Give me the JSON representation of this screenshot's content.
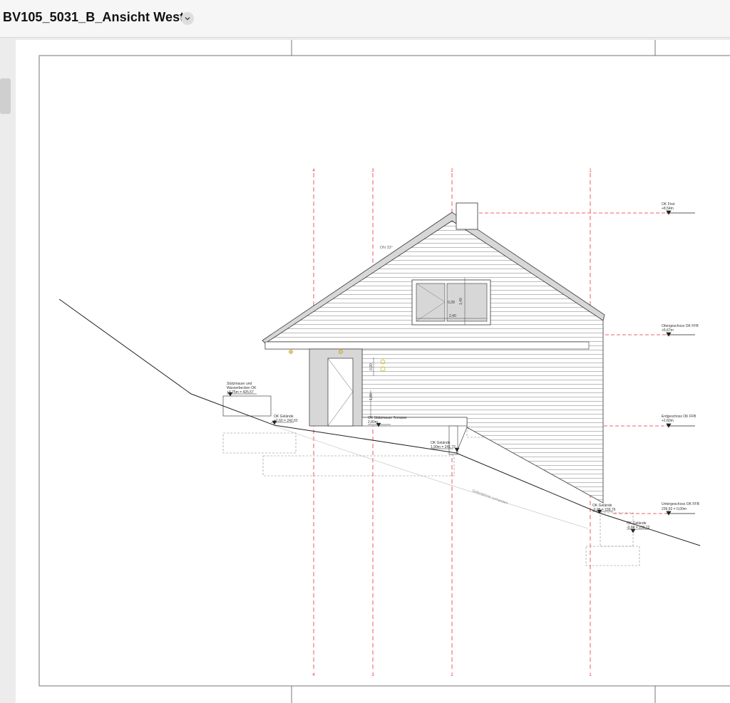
{
  "window": {
    "title": "BV105_5031_B_Ansicht West",
    "menu_icon": "chevron-down-icon"
  },
  "drawing": {
    "grid_axes": [
      "4",
      "3",
      "2",
      "1"
    ],
    "roof_label": "DN 33°",
    "window_dims": {
      "width": "2,40",
      "height": "1,40",
      "sill": "0,28"
    },
    "door_dims": {
      "a": "0,90",
      "b": "1,80"
    },
    "levels": {
      "first": {
        "label": "OK First",
        "value": "+8,54m"
      },
      "og": {
        "label": "Obergeschoss OK FFB",
        "value": "+5,67m"
      },
      "eg": {
        "label": "Erdgeschoss OK FFB",
        "value": "+2,60m"
      },
      "ug": {
        "label": "Untergeschoss OK FFB",
        "value": "239,92 = 0,00m"
      }
    },
    "annotations": {
      "stuetz_title1": "Stützmauer und",
      "stuetz_title2": "Wasserbecken OK",
      "stuetz_value": "+3,75m = 425,57",
      "gel1_label": "OK Gelände",
      "gel1_value": "+2,60 = 242,62",
      "terr_label": "OK Stützmauer Terrasse",
      "terr_value": "2,80m",
      "gel2_label": "OK Gelände",
      "gel2_value": "1,90m = 241,72",
      "gel3_label": "OK Gelände",
      "gel3_value": "-0,05 = 239,76",
      "gel4_label": "OK Gelände",
      "gel4_value": "-0,69 = 239,22",
      "existing": "Geländelinie vorhanden"
    },
    "colors": {
      "axis": "#e8303a",
      "ink": "#222222",
      "fill": "#d7d7d7"
    }
  }
}
